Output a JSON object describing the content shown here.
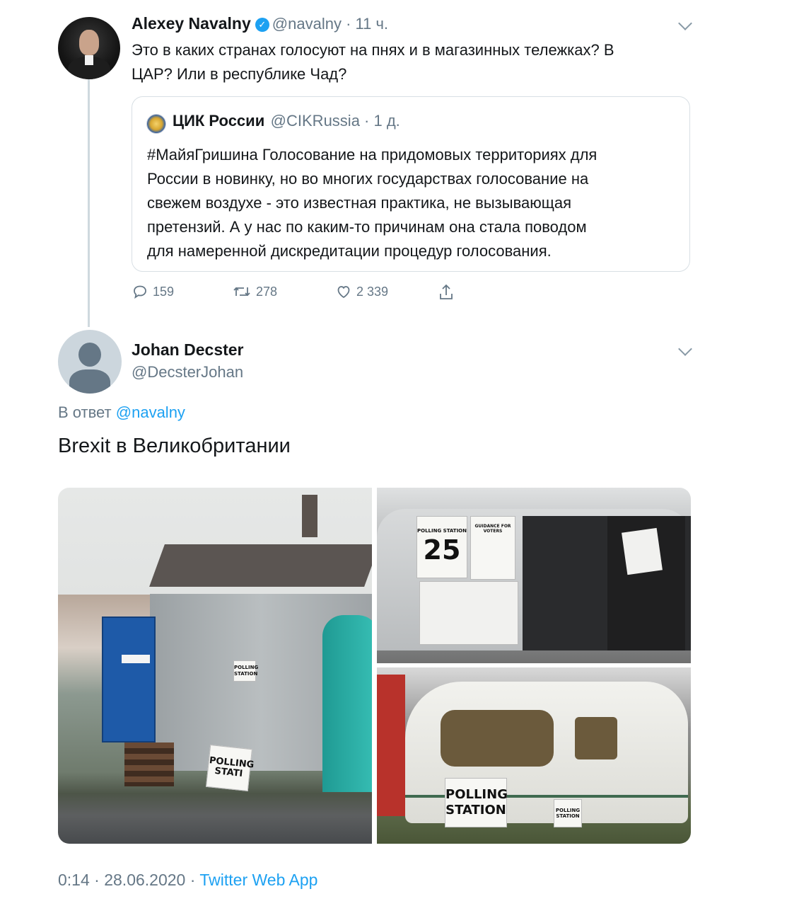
{
  "tweet": {
    "author_name": "Alexey Navalny",
    "handle": "@navalny",
    "time": "11 ч.",
    "text_line1": "Это в каких странах голосуют на пнях и в магазинных тележках? В",
    "text_line2": "ЦАР? Или в республике Чад?",
    "quoted": {
      "author_name": "ЦИК России",
      "handle": "@CIKRussia",
      "time": "1 д.",
      "lines": [
        "#МайяГришина Голосование на придомовых территориях для",
        "России  в новинку, но во многих государствах голосование на",
        "свежем воздухе - это известная практика, не вызывающая",
        "претензий. А у нас по каким-то причинам она стала поводом",
        "для намеренной дискредитации процедур голосования."
      ]
    },
    "actions": {
      "replies": "159",
      "retweets": "278",
      "likes": "2 339"
    }
  },
  "reply": {
    "author_name": "Johan Decster",
    "handle": "@DecsterJohan",
    "reply_to_prefix": "В ответ",
    "reply_to_handle": "@navalny",
    "text": "Brexit в Великобритании",
    "photos": {
      "photo1_sign_1": "POLLING STATION",
      "photo1_sign_2": "POLLING",
      "photo1_sign_3": "STATI",
      "photo2_sign_title": "POLLING STATION",
      "photo2_sign_number": "25",
      "photo2_guidance": "GUIDANCE FOR VOTERS",
      "photo3_sign_1": "POLLING",
      "photo3_sign_2": "STATION",
      "photo3_sign_small": "POLLING STATION"
    },
    "footer": {
      "time": "0:14",
      "date": "28.06.2020",
      "app": "Twitter Web App",
      "separator": "·"
    }
  },
  "colors": {
    "accent": "#1da1f2",
    "secondary_text": "#657786",
    "border": "#d8dfe4"
  }
}
